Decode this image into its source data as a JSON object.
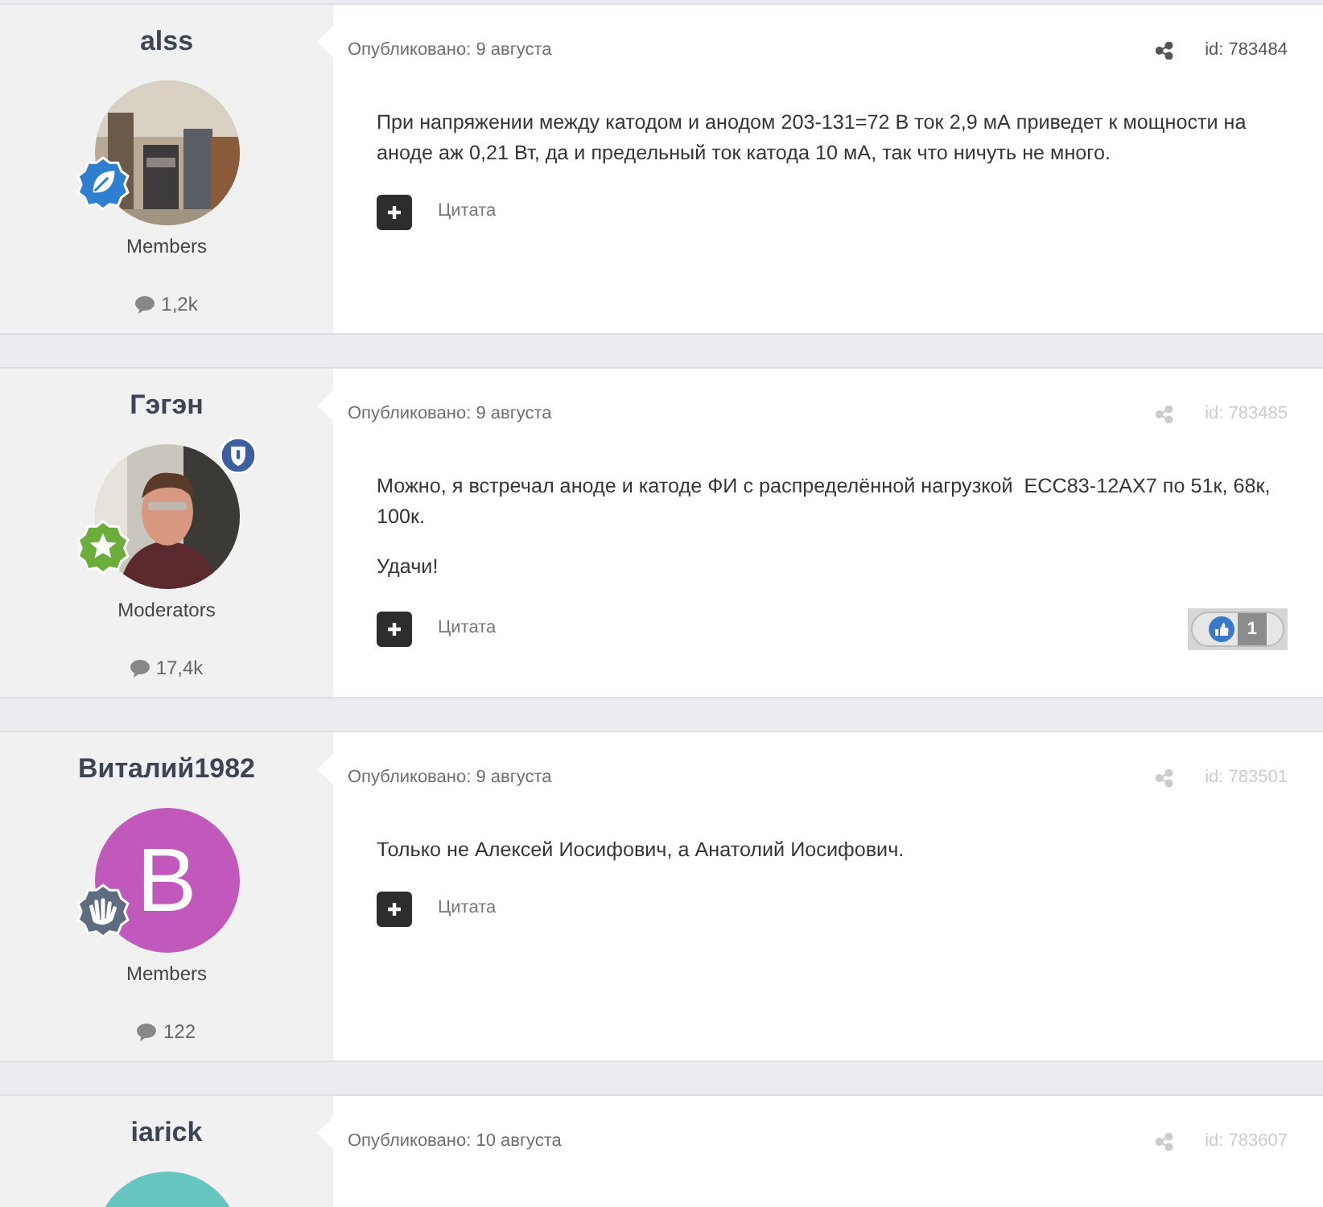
{
  "posts": [
    {
      "author": "alss",
      "avatar": {
        "kind": "picture"
      },
      "badge": {
        "kind": "leaf",
        "color": "#2f7fd0"
      },
      "moderator": false,
      "role": "Members",
      "post_count": "1,2k",
      "published": "Опубликовано: 9 августа",
      "id": "id: 783484",
      "meta_highlighted": true,
      "paragraphs": [
        "При напряжении между катодом и анодом 203-131=72 В ток 2,9 мА приведет к мощности на аноде аж 0,21 Вт, да и предельный ток катода 10 мА, так что ничуть не много."
      ],
      "quote": "Цитата"
    },
    {
      "author": "Гэгэн",
      "avatar": {
        "kind": "picture"
      },
      "badge": {
        "kind": "star",
        "color": "#6cae3c"
      },
      "moderator": true,
      "role": "Moderators",
      "post_count": "17,4k",
      "published": "Опубликовано: 9 августа",
      "id": "id: 783485",
      "meta_highlighted": false,
      "paragraphs": [
        "Можно, я встречал аноде и катоде ФИ с распределённой нагрузкой  ECC83-12AX7 по 51к, 68к, 100к.",
        "Удачи!"
      ],
      "quote": "Цитата",
      "reaction": {
        "count": "1"
      }
    },
    {
      "author": "Виталий1982",
      "avatar": {
        "kind": "letter",
        "letter": "В",
        "color": "#c159bc"
      },
      "badge": {
        "kind": "hand",
        "color": "#5f6b80"
      },
      "moderator": false,
      "role": "Members",
      "post_count": "122",
      "published": "Опубликовано: 9 августа",
      "id": "id: 783501",
      "meta_highlighted": false,
      "paragraphs": [
        "Только не Алексей Иосифович, а Анатолий Иосифович."
      ],
      "quote": "Цитата"
    },
    {
      "author": "iarick",
      "avatar": {
        "kind": "letter",
        "color": "#66c5bf"
      },
      "moderator": false,
      "published": "Опубликовано: 10 августа",
      "id": "id: 783607",
      "meta_highlighted": false
    }
  ]
}
